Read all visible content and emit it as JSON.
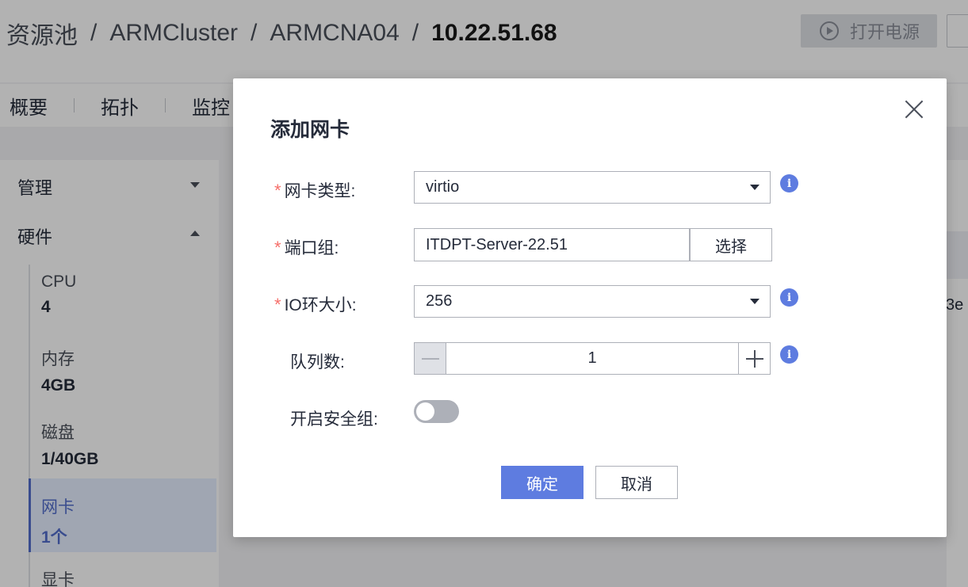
{
  "header": {
    "breadcrumb": [
      "资源池",
      "ARMCluster",
      "ARMCNA04"
    ],
    "breadcrumb_current": "10.22.51.68",
    "breadcrumb_separator": "/",
    "power_button_label": "打开电源"
  },
  "tabs": [
    "概要",
    "拓扑",
    "监控"
  ],
  "sidebar": {
    "groups": [
      {
        "label": "管理",
        "expanded": false
      },
      {
        "label": "硬件",
        "expanded": true
      }
    ],
    "hardware": [
      {
        "label": "CPU",
        "value": "4"
      },
      {
        "label": "内存",
        "value": "4GB"
      },
      {
        "label": "磁盘",
        "value": "1/40GB"
      },
      {
        "label": "网卡",
        "value": "1个",
        "active": true
      },
      {
        "label": "显卡",
        "value": ""
      }
    ]
  },
  "right_panel": {
    "partial_text": "3e"
  },
  "dialog": {
    "title": "添加网卡",
    "required_mark": "*",
    "fields": {
      "nic_type": {
        "label": "网卡类型:",
        "value": "virtio",
        "required": true
      },
      "port_group": {
        "label": "端口组:",
        "value": "ITDPT-Server-22.51",
        "required": true,
        "choose_label": "选择"
      },
      "io_ring": {
        "label": "IO环大小:",
        "value": "256",
        "required": true
      },
      "queue_count": {
        "label": "队列数:",
        "value": "1",
        "required": false
      },
      "security_group": {
        "label": "开启安全组:",
        "enabled": false,
        "required": false
      }
    },
    "info_glyph": "i",
    "ok_label": "确定",
    "cancel_label": "取消"
  },
  "colors": {
    "primary": "#5e7ce0",
    "required": "#f66f6a",
    "active_nav_bg": "#e6eeff",
    "toggle_off": "#adb0b8"
  },
  "icons": {
    "power": "power-icon",
    "close": "close-icon",
    "info": "info-icon",
    "dropdown": "chevron-down-icon"
  }
}
